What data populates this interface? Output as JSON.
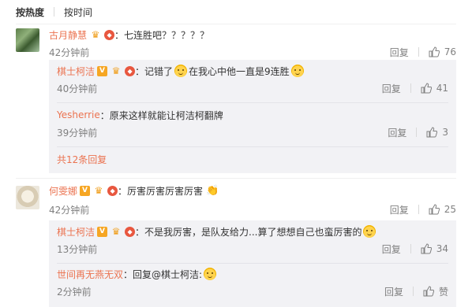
{
  "sort": {
    "hot": "按热度",
    "time": "按时间"
  },
  "comments": [
    {
      "user": "古月静慧",
      "text": "七连胜吧？？？？？",
      "time": "42分钟前",
      "reply": "回复",
      "likes": "76",
      "replies": [
        {
          "user": "棋士柯洁",
          "text_a": "记错了",
          "text_b": "在我心中他一直是9连胜",
          "time": "40分钟前",
          "reply": "回复",
          "likes": "41"
        },
        {
          "user": "Yesherrie",
          "text": "原来这样就能让柯洁柯翻牌",
          "time": "39分钟前",
          "reply": "回复",
          "likes": "3"
        }
      ],
      "more": "共12条回复"
    },
    {
      "user": "何雯娜",
      "text": "厉害厉害厉害厉害",
      "time": "42分钟前",
      "reply": "回复",
      "likes": "25",
      "replies": [
        {
          "user": "棋士柯洁",
          "text": "不是我厉害，是队友给力...算了想想自己也蛮厉害的",
          "time": "13分钟前",
          "reply": "回复",
          "likes": "34"
        },
        {
          "user": "世间再无燕无双",
          "text_a": "回复@棋士柯洁:",
          "time": "2分钟前",
          "reply": "回复",
          "likes": "赞"
        }
      ]
    }
  ],
  "colors": {
    "username": "#eb7350",
    "text": "#333333",
    "meta": "#808080",
    "reply_bg": "#f2f2f5"
  },
  "icons": {
    "like": "thumb-up-icon",
    "emoji": "doge-emoji-icon",
    "verified": "v-badge-icon"
  }
}
